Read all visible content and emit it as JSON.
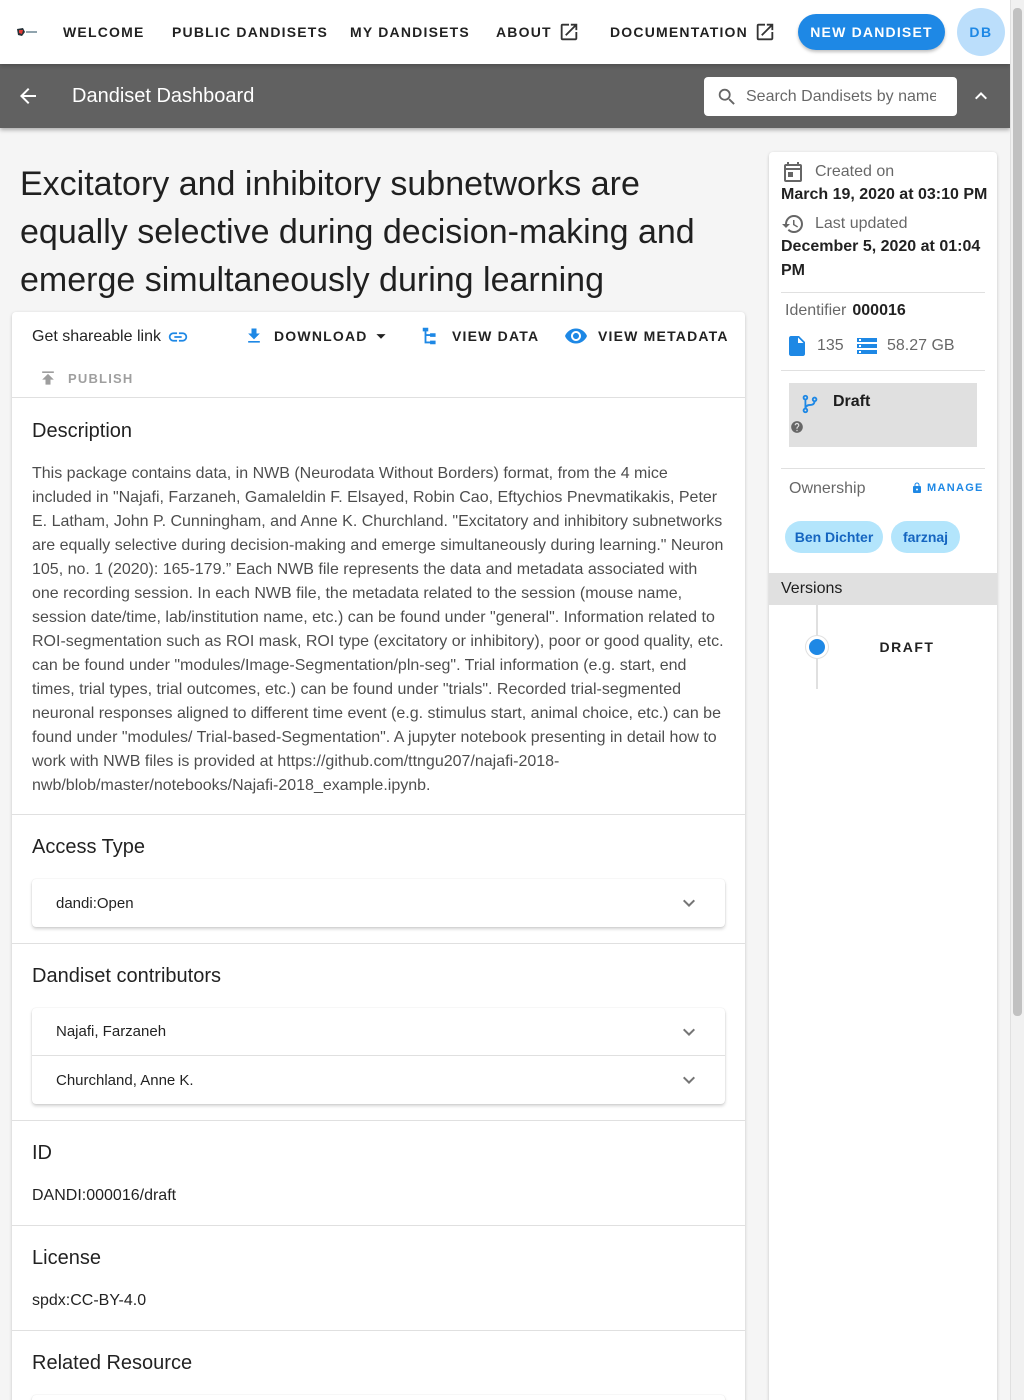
{
  "nav": {
    "welcome": "WELCOME",
    "public_dandisets": "PUBLIC DANDISETS",
    "my_dandisets": "MY DANDISETS",
    "about": "ABOUT",
    "documentation": "DOCUMENTATION",
    "new_dandiset": "NEW DANDISET",
    "avatar_initials": "DB"
  },
  "toolbar": {
    "title": "Dandiset Dashboard",
    "search_placeholder": "Search Dandisets by name, description, identifier, or contributor name"
  },
  "dandiset": {
    "title": "Excitatory and inhibitory subnetworks are equally selective during decision-making and emerge simultaneously during learning",
    "actions": {
      "share": "Get shareable link",
      "download": "DOWNLOAD",
      "view_data": "VIEW DATA",
      "view_metadata": "VIEW METADATA",
      "publish": "PUBLISH"
    },
    "description_label": "Description",
    "description": "This package contains data, in NWB (Neurodata Without Borders) format, from the 4 mice included in \"Najafi, Farzaneh, Gamaleldin F. Elsayed, Robin Cao, Eftychios Pnevmatikakis, Peter E. Latham, John P. Cunningham, and Anne K. Churchland. \"Excitatory and inhibitory subnetworks are equally selective during decision-making and emerge simultaneously during learning.\" Neuron 105, no. 1 (2020): 165-179.” Each NWB file represents the data and metadata associated with one recording session. In each NWB file, the metadata related to the session (mouse name, session date/time, lab/institution name, etc.) can be found under \"general\". Information related to ROI-segmentation such as ROI mask, ROI type (excitatory or inhibitory), poor or good quality, etc. can be found under \"modules/Image-Segmentation/pln-seg\". Trial information (e.g. start, end times, trial types, trial outcomes, etc.) can be found under \"trials\". Recorded trial-segmented neuronal responses aligned to different time event (e.g. stimulus start, animal choice, etc.) can be found under \"modules/ Trial-based-Segmentation\". A jupyter notebook presenting in detail how to work with NWB files is provided at https://github.com/ttngu207/najafi-2018-nwb/blob/master/notebooks/Najafi-2018_example.ipynb.",
    "access_type_label": "Access Type",
    "access_type": "dandi:Open",
    "contributors_label": "Dandiset contributors",
    "contributors": [
      "Najafi, Farzaneh",
      "Churchland, Anne K."
    ],
    "id_label": "ID",
    "id_value": "DANDI:000016/draft",
    "license_label": "License",
    "license_value": "spdx:CC-BY-4.0",
    "related_resource_label": "Related Resource"
  },
  "sidebar": {
    "created_label": "Created on",
    "created_value": "March 19, 2020 at 03:10 PM",
    "updated_label": "Last updated",
    "updated_value": "December 5, 2020 at 01:04 PM",
    "identifier_label": "Identifier",
    "identifier_value": "000016",
    "file_count": "135",
    "size": "58.27 GB",
    "status": "Draft",
    "ownership_label": "Ownership",
    "manage": "MANAGE",
    "owners": [
      "Ben Dichter",
      "farznaj"
    ],
    "versions_label": "Versions",
    "version": "DRAFT"
  },
  "colors": {
    "primary": "#1e88e5",
    "toolbar": "#616161",
    "chip": "#b3e5fc"
  }
}
